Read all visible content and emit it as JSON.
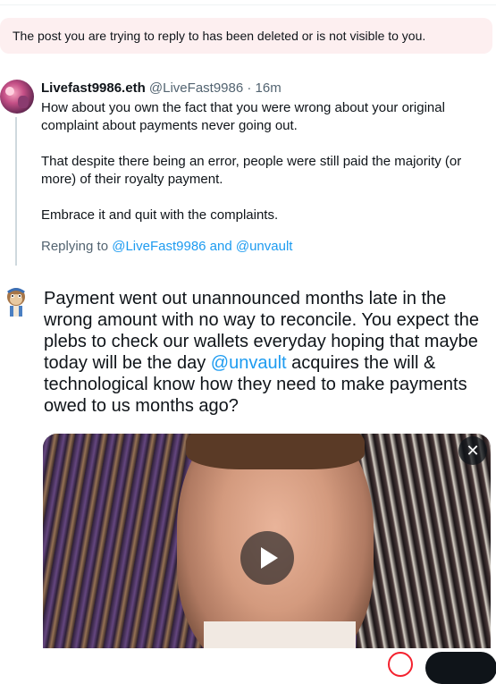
{
  "notice": {
    "text": "The post you are trying to reply to has been deleted or is not visible to you."
  },
  "reply_tweet": {
    "display_name": "Livefast9986.eth",
    "handle_and_time": "@LiveFast9986 · 16m",
    "paragraphs": [
      "How about you own the fact that you were wrong about your original complaint about payments never going out.",
      "That despite there being an error, people were still paid the majority (or more) of their royalty payment.",
      "Embrace it and quit with the complaints."
    ],
    "replying_prefix": "Replying to ",
    "replying_to": "@LiveFast9986 and @unvault"
  },
  "compose": {
    "text_before": "Payment went out unannounced months late in the wrong amount with no way to reconcile. You expect the plebs to check our wallets everyday hoping that maybe today will be the day ",
    "mention": "@unvault",
    "text_after": " acquires the will & technological know how they need to make payments owed to us months ago?",
    "media_close_symbol": "✕"
  },
  "icons": {
    "avatar_reply": "avatar-image",
    "avatar_compose": "ape-avatar-icon",
    "close": "close-icon",
    "play": "play-icon"
  },
  "colors": {
    "link": "#1d9bf0",
    "notice_bg": "#fdeff0",
    "muted": "#536471"
  }
}
